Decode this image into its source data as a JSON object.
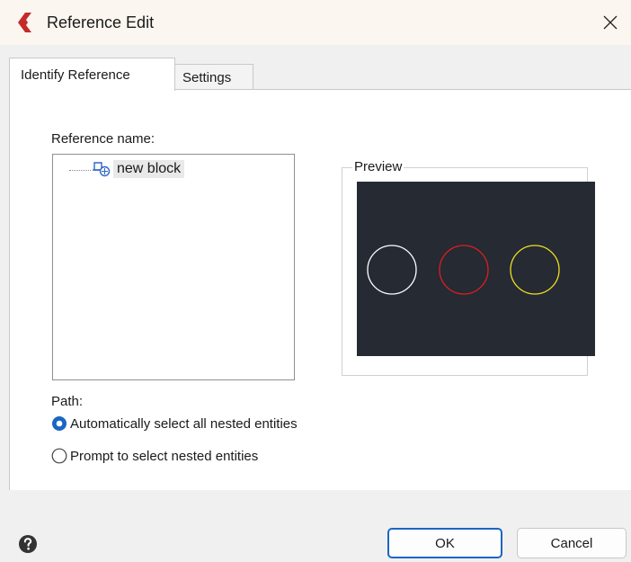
{
  "window": {
    "title": "Reference Edit",
    "close_glyph": "✕",
    "logo_icon": "app-logo-icon",
    "logo_color": "#c42b2b"
  },
  "tabs": [
    {
      "label": "Identify Reference",
      "active": true
    },
    {
      "label": "Settings",
      "active": false
    }
  ],
  "reference": {
    "label": "Reference name:",
    "items": [
      {
        "label": "new block",
        "icon": "block-reference-icon"
      }
    ]
  },
  "preview": {
    "label": "Preview",
    "background": "#252a33",
    "circles": [
      {
        "color": "#ffffff"
      },
      {
        "color": "#e01e1e"
      },
      {
        "color": "#f0e020"
      }
    ]
  },
  "path": {
    "label": "Path:",
    "options": [
      {
        "label": "Automatically select all nested entities",
        "selected": true
      },
      {
        "label": "Prompt to select nested entities",
        "selected": false
      }
    ]
  },
  "buttons": {
    "ok": "OK",
    "cancel": "Cancel"
  },
  "colors": {
    "accent": "#1a66c2"
  }
}
